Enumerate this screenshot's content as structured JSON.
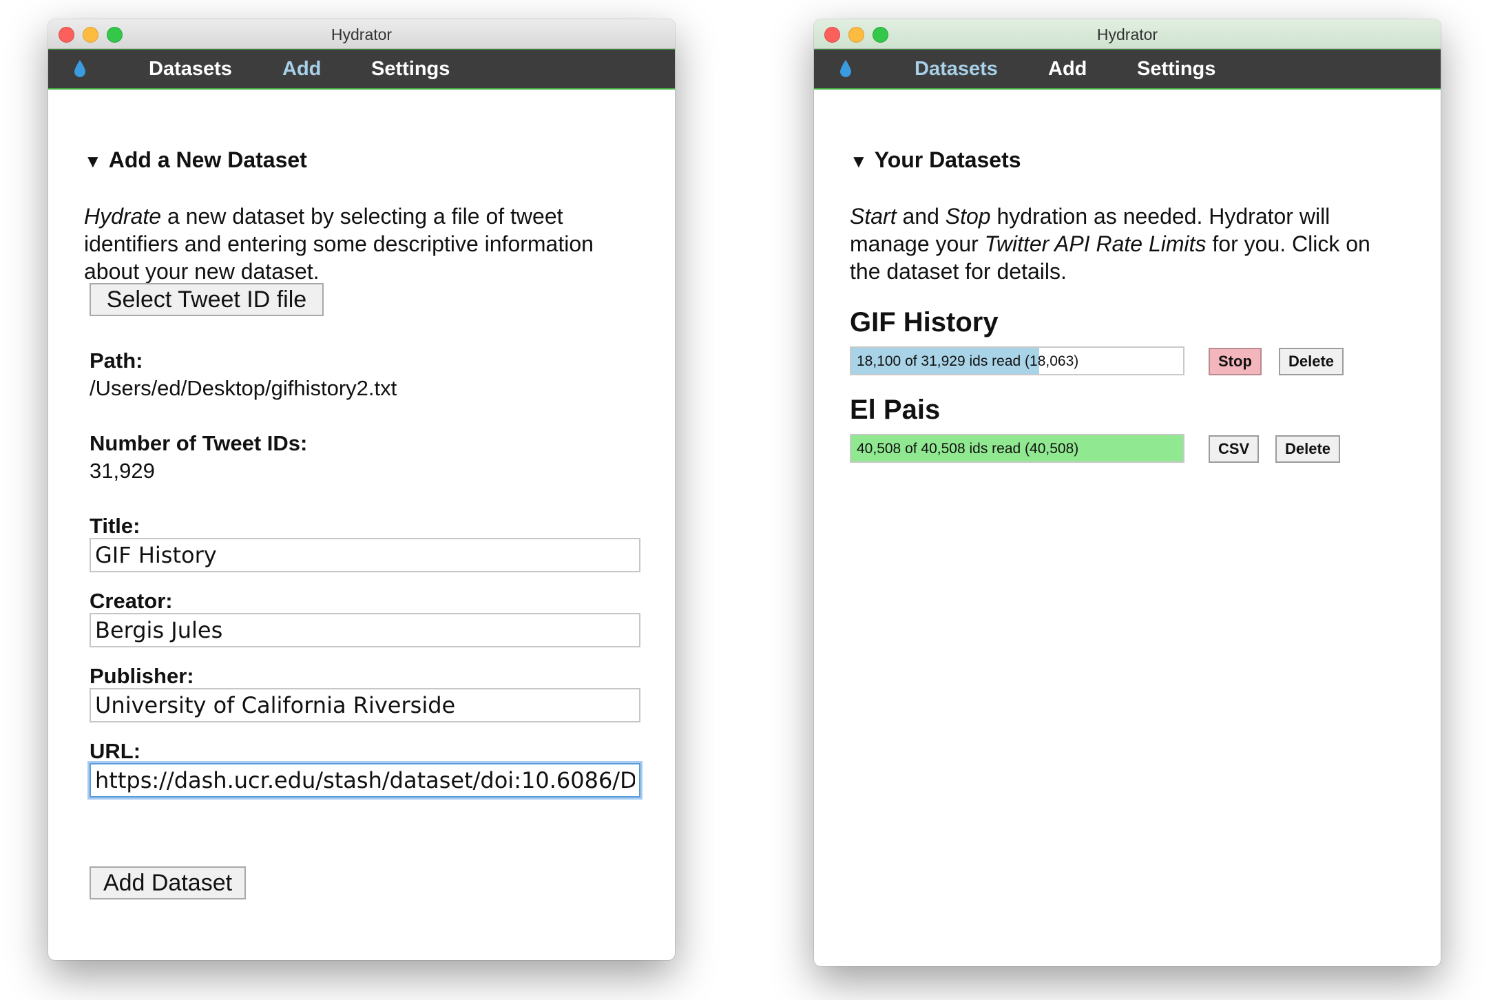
{
  "left_window": {
    "title": "Hydrator",
    "nav": {
      "datasets": "Datasets",
      "add": "Add",
      "settings": "Settings",
      "active": "add"
    },
    "section_title": "Add a New Dataset",
    "description": {
      "em": "Hydrate",
      "line1_rest": " a new dataset by selecting a file of tweet",
      "line2": "identifiers and entering some descriptive information",
      "line3": "about your new dataset."
    },
    "select_button": "Select Tweet ID file",
    "path_label": "Path:",
    "path_value": "/Users/ed/Desktop/gifhistory2.txt",
    "count_label": "Number of Tweet IDs:",
    "count_value": "31,929",
    "title_label": "Title:",
    "title_value": "GIF History",
    "creator_label": "Creator:",
    "creator_value": "Bergis Jules",
    "publisher_label": "Publisher:",
    "publisher_value": "University of California Riverside",
    "url_label": "URL:",
    "url_value": "https://dash.ucr.edu/stash/dataset/doi:10.6086/D",
    "add_button": "Add Dataset"
  },
  "right_window": {
    "title": "Hydrator",
    "nav": {
      "datasets": "Datasets",
      "add": "Add",
      "settings": "Settings",
      "active": "datasets"
    },
    "section_title": "Your Datasets",
    "description": {
      "em1": "Start",
      "t1": " and ",
      "em2": "Stop",
      "t2": " hydration as needed. Hydrator will",
      "line2_pre": "manage your ",
      "em3": "Twitter API Rate Limits",
      "line2_post": " for you. Click on",
      "line3": "the dataset for details."
    },
    "datasets": [
      {
        "name": "GIF History",
        "progress_text": "18,100 of 31,929 ids read (18,063)",
        "progress_fraction": 0.567,
        "fill_color": "#a9d3e6",
        "buttons": [
          "Stop",
          "Delete"
        ]
      },
      {
        "name": "El Pais",
        "progress_text": "40,508 of 40,508 ids read (40,508)",
        "progress_fraction": 1.0,
        "fill_color": "#90e890",
        "buttons": [
          "CSV",
          "Delete"
        ]
      }
    ]
  }
}
